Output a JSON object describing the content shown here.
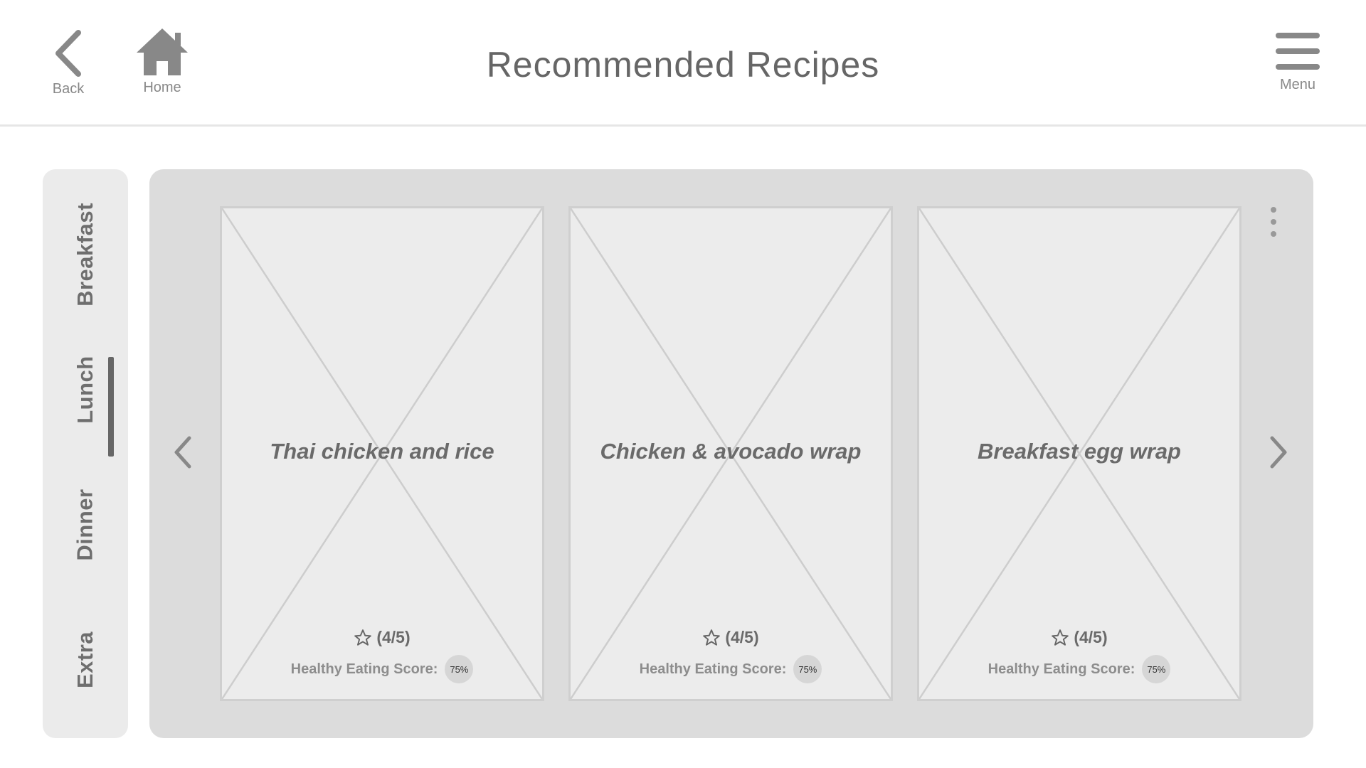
{
  "header": {
    "back_label": "Back",
    "home_label": "Home",
    "menu_label": "Menu",
    "title": "Recommended Recipes"
  },
  "categories": {
    "items": [
      {
        "label": "Breakfast"
      },
      {
        "label": "Lunch"
      },
      {
        "label": "Dinner"
      },
      {
        "label": "Extra"
      }
    ],
    "selected": "Lunch"
  },
  "recipes": [
    {
      "name": "Thai chicken and rice",
      "rating": "(4/5)",
      "score_label": "Healthy Eating Score:",
      "score": "75%"
    },
    {
      "name": "Chicken & avocado wrap",
      "rating": "(4/5)",
      "score_label": "Healthy Eating Score:",
      "score": "75%"
    },
    {
      "name": "Breakfast egg wrap",
      "rating": "(4/5)",
      "score_label": "Healthy Eating Score:",
      "score": "75%"
    }
  ],
  "icons": {
    "back": "chevron-left-icon",
    "home": "home-icon",
    "menu": "hamburger-menu-icon",
    "prev": "chevron-left-icon",
    "next": "chevron-right-icon",
    "more": "vertical-dots-icon",
    "rating": "star-outline-icon"
  },
  "colors": {
    "panel_bg": "#dcdcdc",
    "card_bg": "#ececec",
    "sidebar_bg": "#ebebeb",
    "text": "#666666"
  }
}
